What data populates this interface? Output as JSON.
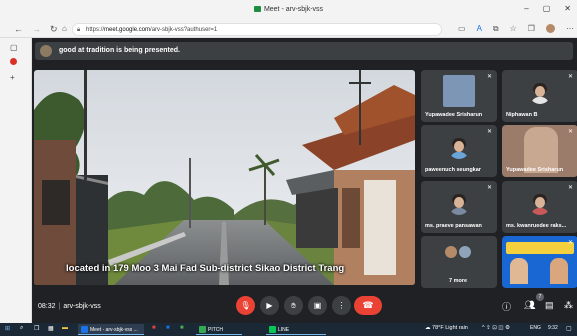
{
  "browser": {
    "tab_title": "Meet - arv-sbjk-vss",
    "url_prefix": "https://",
    "url_host": "meet.google.com",
    "url_rest": "/arv-sbjk-vss?authuser=1",
    "back_icon": "arrow-left-icon",
    "forward_icon": "arrow-right-icon",
    "reload_icon": "reload-icon",
    "home_icon": "home-icon",
    "lock_icon": "lock-icon"
  },
  "window_controls": {
    "minimize": "–",
    "maximize": "▢",
    "close": "✕"
  },
  "meet": {
    "banner_text": "good at tradition is being presented.",
    "caption": "located in 179 Moo 3 Mai Fad Sub-district Sikao District Trang",
    "meeting_time": "08:32",
    "meeting_code": "arv-sbjk-vss",
    "participant_count": "7",
    "participants": [
      {
        "name": "Yupawadee Srisharun"
      },
      {
        "name": "Niphawan B"
      },
      {
        "name": "paweenuch seungkar"
      },
      {
        "name": "Yupawadee Srisharun"
      },
      {
        "name": "ms. praeve pansawan"
      },
      {
        "name": "ms. kwanruedee raks..."
      },
      {
        "name": "7 more"
      },
      {
        "name": ""
      }
    ]
  },
  "taskbar": {
    "apps": [
      {
        "label": "Meet - arv-sbjk-vss ..."
      },
      {
        "label": "PITCH"
      },
      {
        "label": "LINE"
      }
    ],
    "weather": "78°F Light rain",
    "language": "ENG",
    "clock": "9:32"
  },
  "colors": {
    "meet_bg": "#202124",
    "tile_bg": "#3c4043",
    "accent_red": "#ea4335",
    "taskbar_bg": "#1b2836"
  }
}
